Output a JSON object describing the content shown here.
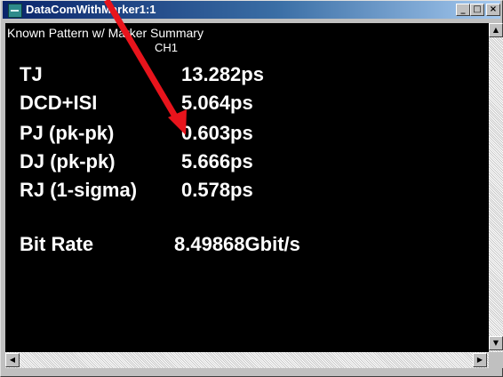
{
  "window": {
    "title": "DataComWithMarker1:1",
    "min_glyph": "_",
    "max_glyph": "□",
    "close_glyph": "×",
    "titlebar_color": "#0a246a"
  },
  "panel": {
    "title": "Known Pattern w/ Marker Summary",
    "channel": "CH1"
  },
  "measurements": [
    {
      "label": "TJ",
      "value": "13.282ps"
    },
    {
      "label": "DCD+ISI",
      "value": "5.064ps"
    },
    {
      "label": "PJ (pk-pk)",
      "value": "0.603ps"
    },
    {
      "label": "DJ (pk-pk)",
      "value": "5.666ps"
    },
    {
      "label": "RJ (1-sigma)",
      "value": "0.578ps"
    }
  ],
  "bit_rate": {
    "label": "Bit Rate",
    "value": "8.49868Gbit/s"
  },
  "scrollbars": {
    "up": "▲",
    "down": "▼",
    "left": "◀",
    "right": "▶"
  },
  "annotation": {
    "arrow_color": "#e8141c"
  }
}
